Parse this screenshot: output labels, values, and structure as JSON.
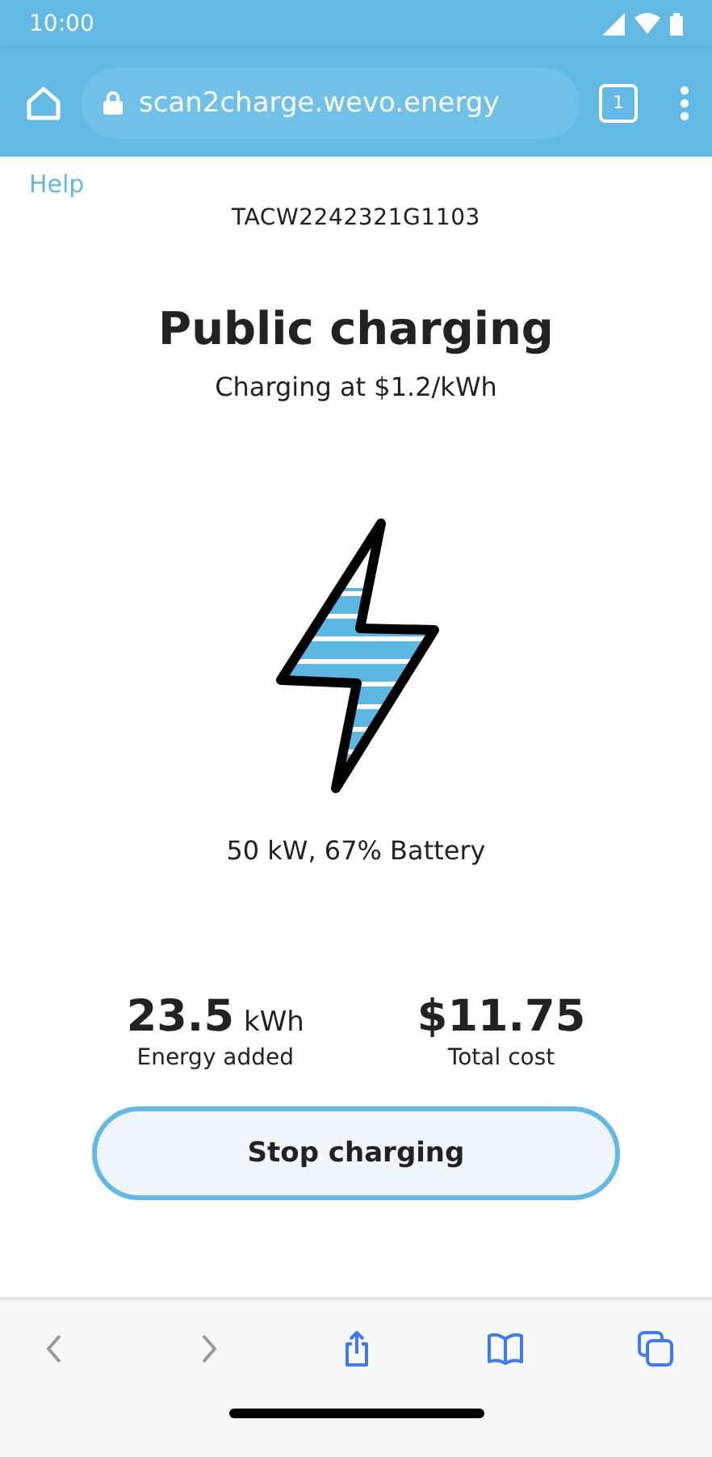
{
  "status_bar": {
    "time": "10:00"
  },
  "browser": {
    "url": "scan2charge.wevo.energy",
    "tab_count": "1"
  },
  "page": {
    "help_link": "Help",
    "charger_id": "TACW2242321G1103",
    "title": "Public charging",
    "rate": "Charging at $1.2/kWh",
    "status": "50 kW, 67% Battery",
    "stats": [
      {
        "value": "23.5",
        "unit": "kWh",
        "label": "Energy added"
      },
      {
        "value": "$11.75",
        "label": "Total cost"
      }
    ],
    "stop_button": "Stop charging"
  },
  "toolbar": [
    {
      "kind": "back",
      "disabled": true
    },
    {
      "kind": "forward",
      "disabled": true
    },
    {
      "kind": "share",
      "disabled": false
    },
    {
      "kind": "bookmarks",
      "disabled": false
    },
    {
      "kind": "tabs",
      "disabled": false
    }
  ]
}
